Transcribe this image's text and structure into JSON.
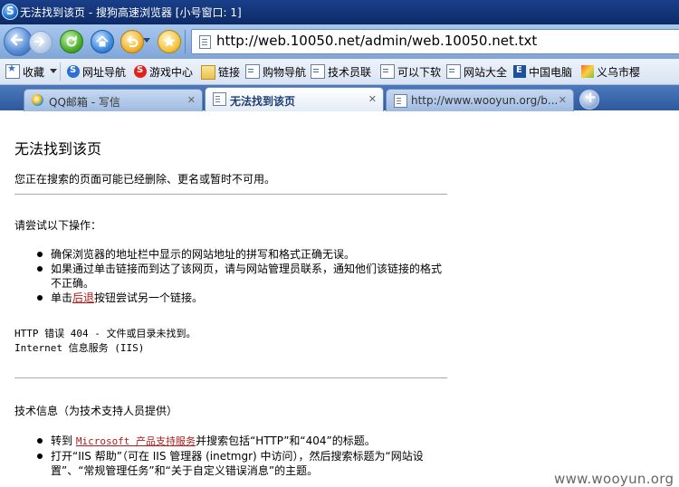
{
  "window": {
    "title": "无法找到该页 - 搜狗高速浏览器 [小号窗口: 1]"
  },
  "toolbar": {
    "back_icon": "back-arrow-icon",
    "forward_icon": "forward-arrow-icon",
    "refresh_icon": "refresh-icon",
    "home_icon": "home-icon",
    "undo_icon": "undo-icon",
    "favorite_icon": "star-icon",
    "address_url": "http://web.10050.net/admin/web.10050.net.txt"
  },
  "bookmarks": {
    "items": [
      {
        "label": "收藏",
        "icon": "favorites-icon"
      },
      {
        "label": "网址导航",
        "icon": "sogou-icon"
      },
      {
        "label": "游戏中心",
        "icon": "game-icon"
      },
      {
        "label": "链接",
        "icon": "folder-icon"
      },
      {
        "label": "购物导航",
        "icon": "page-icon"
      },
      {
        "label": "技术员联",
        "icon": "page-icon"
      },
      {
        "label": "可以下软",
        "icon": "page-icon"
      },
      {
        "label": "网站大全",
        "icon": "page-icon"
      },
      {
        "label": "中国电脑",
        "icon": "e-icon"
      },
      {
        "label": "义乌市樱",
        "icon": "yiwu-icon"
      }
    ]
  },
  "tabs": [
    {
      "label": "QQ邮箱 - 写信",
      "active": false
    },
    {
      "label": "无法找到该页",
      "active": true
    },
    {
      "label": "http://www.wooyun.org/b...",
      "active": false
    }
  ],
  "content": {
    "heading": "无法找到该页",
    "subtitle": "您正在搜索的页面可能已经删除、更名或暂时不可用。",
    "try_heading": "请尝试以下操作：",
    "tips": {
      "t1": "确保浏览器的地址栏中显示的网站地址的拼写和格式正确无误。",
      "t2": "如果通过单击链接而到达了该网页，请与网站管理员联系，通知他们该链接的格式不正确。",
      "t3_pre": "单击",
      "t3_link": "后退",
      "t3_post": "按钮尝试另一个链接。"
    },
    "error_line1": "HTTP 错误 404 - 文件或目录未找到。",
    "error_line2": "Internet 信息服务 (IIS)",
    "tech_heading": "技术信息（为技术支持人员提供）",
    "tech": {
      "t1_pre": "转到 ",
      "t1_link": "Microsoft 产品支持服务",
      "t1_post": "并搜索包括“HTTP”和“404”的标题。",
      "t2": "打开“IIS 帮助”（可在 IIS 管理器 (inetmgr) 中访问），然后搜索标题为“网站设置”、“常规管理任务”和“关于自定义错误消息”的主题。"
    }
  },
  "watermark": "www.wooyun.org"
}
